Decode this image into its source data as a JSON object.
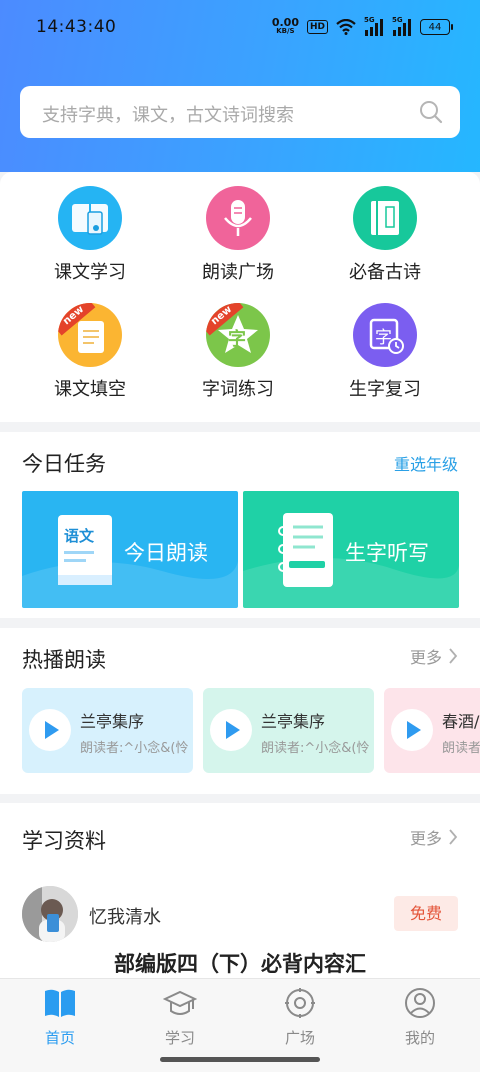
{
  "statusbar": {
    "time": "14:43:40",
    "netspeed_value": "0.00",
    "netspeed_unit": "KB/S",
    "hd": "HD",
    "signal1": "5G",
    "signal2": "5G",
    "battery": "44"
  },
  "search": {
    "placeholder": "支持字典，课文，古文诗词搜索"
  },
  "features": [
    {
      "label": "课文学习",
      "color": "#25b4f3",
      "icon": "book-tablet-icon"
    },
    {
      "label": "朗读广场",
      "color": "#f0649a",
      "icon": "microphone-icon"
    },
    {
      "label": "必备古诗",
      "color": "#17c89b",
      "icon": "scroll-book-icon"
    },
    {
      "label": "课文填空",
      "color": "#fbb532",
      "icon": "note-icon",
      "badge": "new"
    },
    {
      "label": "字词练习",
      "color": "#7cc64a",
      "icon": "star-word-icon",
      "badge": "new",
      "glyph": "字"
    },
    {
      "label": "生字复习",
      "color": "#7b5ef0",
      "icon": "word-clock-icon",
      "glyph": "字"
    }
  ],
  "today_task": {
    "title": "今日任务",
    "link": "重选年级",
    "items": [
      {
        "label": "今日朗读",
        "book_text": "语文",
        "color": "#29b5f2",
        "icon": "chinese-book-icon"
      },
      {
        "label": "生字听写",
        "color": "#1fd1a6",
        "icon": "notebook-pen-icon"
      }
    ]
  },
  "hot_reading": {
    "title": "热播朗读",
    "more": "更多",
    "items": [
      {
        "title": "兰亭集序",
        "reader": "朗读者:^小念&(怜",
        "bg": "#d7f1fd"
      },
      {
        "title": "兰亭集序",
        "reader": "朗读者:^小念&(怜",
        "bg": "#d5f5ec"
      },
      {
        "title": "春酒/",
        "reader": "朗读者",
        "bg": "#fde4ea"
      }
    ]
  },
  "study_material": {
    "title": "学习资料",
    "more": "更多",
    "user": "忆我清水",
    "badge": "免费",
    "doc_title": "部编版四（下）必背内容汇"
  },
  "tabbar": [
    {
      "label": "首页",
      "icon": "book-icon",
      "active": true
    },
    {
      "label": "学习",
      "icon": "graduation-cap-icon",
      "active": false
    },
    {
      "label": "广场",
      "icon": "compass-icon",
      "active": false
    },
    {
      "label": "我的",
      "icon": "user-icon",
      "active": false
    }
  ],
  "colors": {
    "accent": "#2aa0e6",
    "tab_active": "#2a9cf0",
    "tab_inactive": "#8a8a8a"
  }
}
